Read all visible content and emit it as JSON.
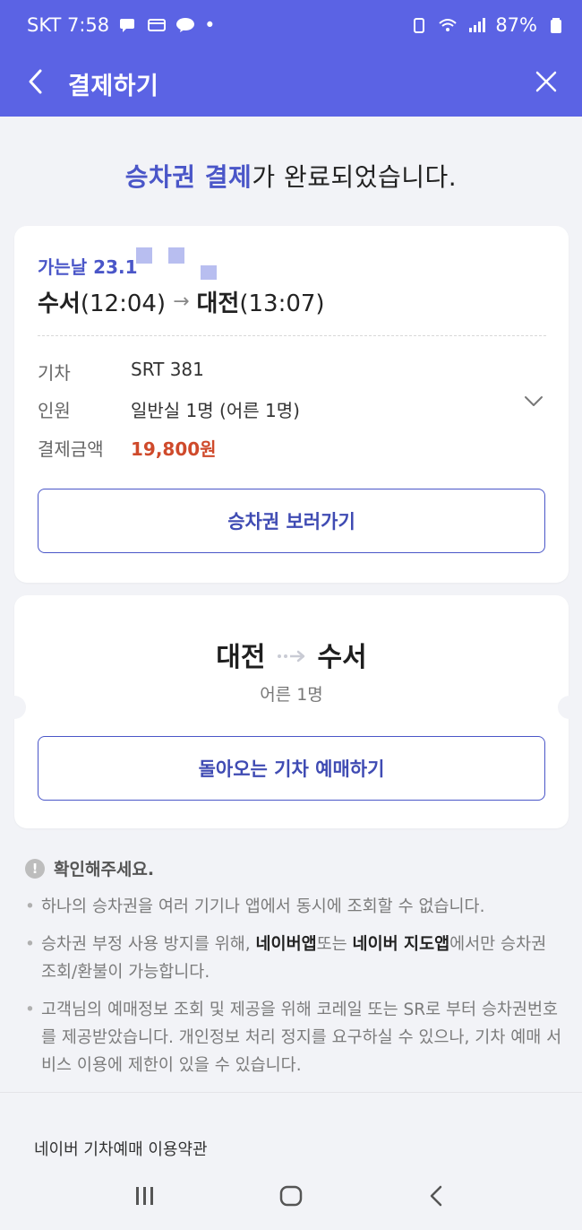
{
  "status_bar": {
    "carrier_time": "SKT 7:58",
    "dot": "•",
    "battery": "87%"
  },
  "app_bar": {
    "title": "결제하기",
    "back_icon": "chevron-left-icon",
    "close_icon": "close-icon"
  },
  "headline": {
    "accent": "승차권 결제",
    "rest": "가 완료되었습니다."
  },
  "ticket": {
    "date_label": "가는날 23.1",
    "origin": "수서",
    "origin_time": "(12:04)",
    "arrow": "→",
    "destination": "대전",
    "destination_time": "(13:07)",
    "rows": {
      "train_label": "기차",
      "train_value": "SRT 381",
      "people_label": "인원",
      "people_value": "일반실 1명 (어른 1명)",
      "price_label": "결제금액",
      "price_value": "19,800원"
    },
    "view_button": "승차권 보러가기"
  },
  "return": {
    "origin": "대전",
    "destination": "수서",
    "passengers": "어른 1명",
    "book_button": "돌아오는 기차 예매하기"
  },
  "notice": {
    "title": "확인해주세요.",
    "items": {
      "item1": "하나의 승차권을 여러 기기나 앱에서 동시에 조회할 수 없습니다.",
      "item2_a": "승차권 부정 사용 방지를 위해, ",
      "item2_b": "네이버앱",
      "item2_c": "또는 ",
      "item2_d": "네이버 지도앱",
      "item2_e": "에서만 승차권 조회/환불이 가능합니다.",
      "item3": "고객님의 예매정보 조회 및 제공을 위해 코레일 또는 SR로 부터 승차권번호를 제공받았습니다. 개인정보 처리 정지를 요구하실 수 있으나, 기차 예매 서비스 이용에 제한이 있을 수 있습니다."
    }
  },
  "footer": {
    "terms_link": "네이버 기차예매 이용약관"
  },
  "colors": {
    "header": "#5b63e4",
    "accent": "#4a56c8",
    "price": "#cf4a2b"
  }
}
